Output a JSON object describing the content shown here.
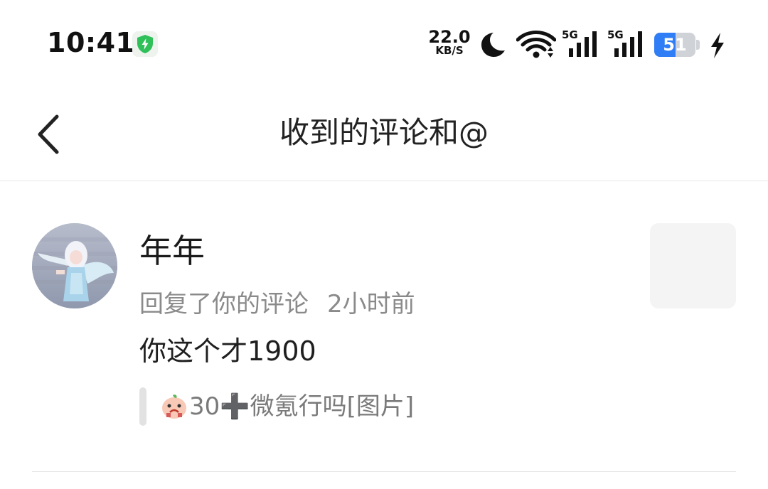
{
  "status_bar": {
    "time": "10:41",
    "net_speed_value": "22.0",
    "net_speed_unit": "KB/S",
    "sim1_label": "5G",
    "sim2_label": "5G",
    "battery_level": "51",
    "battery_fraction": 0.51,
    "icons": [
      "shield-icon",
      "moon-icon",
      "wifi-icon",
      "signal-icon",
      "signal-icon",
      "battery-icon",
      "charging-bolt-icon"
    ],
    "colors": {
      "shield": "#2fc05a",
      "battery_fill": "#2f7ef5"
    }
  },
  "header": {
    "title": "收到的评论和@",
    "back_icon": "chevron-left-icon"
  },
  "notifications": [
    {
      "user_name": "年年",
      "action": "回复了你的评论",
      "time_ago": "2小时前",
      "comment": "你这个才1900",
      "quoted_text": "30➕微氪行吗[图片]",
      "quoted_emoji_icon": "sticker-emoji-icon"
    }
  ]
}
